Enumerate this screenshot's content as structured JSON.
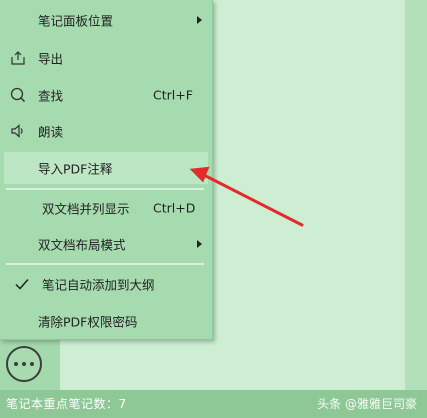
{
  "menu": {
    "items": [
      {
        "label": "笔记面板位置",
        "has_submenu": true
      },
      {
        "label": "导出",
        "icon": "export-icon"
      },
      {
        "label": "查找",
        "icon": "search-icon",
        "shortcut": "Ctrl+F"
      },
      {
        "label": "朗读",
        "icon": "speaker-icon"
      },
      {
        "label": "导入PDF注释",
        "highlighted": true
      },
      {
        "label": "双文档并列显示",
        "shortcut": "Ctrl+D"
      },
      {
        "label": "双文档布局模式",
        "has_submenu": true
      },
      {
        "label": "笔记自动添加到大纲",
        "icon": "checkmark-icon",
        "checked": true
      },
      {
        "label": "清除PDF权限密码"
      }
    ]
  },
  "status_bar": {
    "text": "笔记本重点笔记数：7",
    "watermark": "头条 @雅雅巨司豪"
  },
  "more_button": {
    "icon": "more-dots-icon"
  },
  "colors": {
    "menu_bg": "#a5dbaf",
    "highlight": "#bde6c4",
    "status_bar": "#8dc896",
    "arrow": "#e32b2b"
  }
}
